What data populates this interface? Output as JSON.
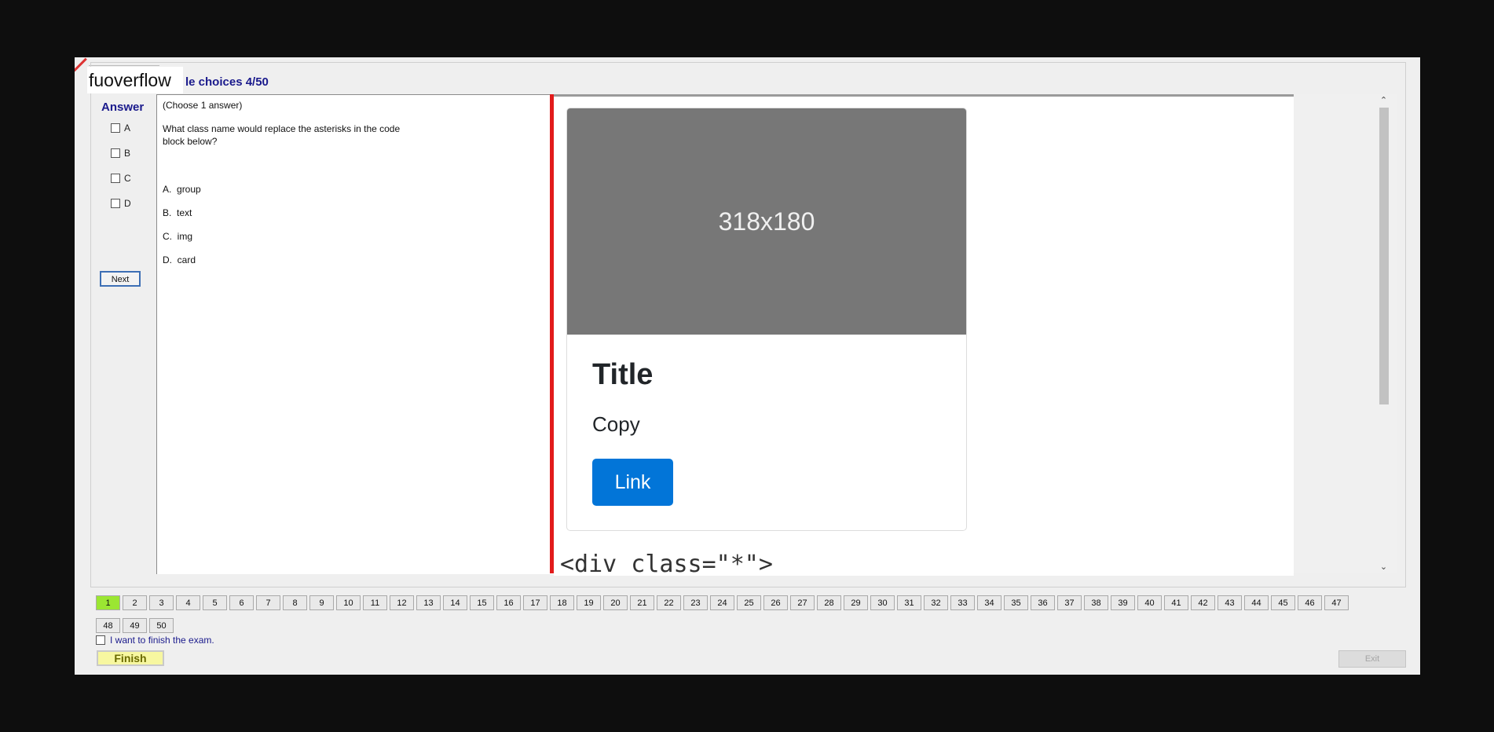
{
  "brand": {
    "name": "fuoverflow"
  },
  "question": {
    "header": "le choices 4/50",
    "instruction": "(Choose 1 answer)",
    "text_line1": "What class name would replace the asterisks in the code",
    "text_line2": "block below?",
    "options": [
      {
        "letter": "A.",
        "text": "group"
      },
      {
        "letter": "B.",
        "text": "text"
      },
      {
        "letter": "C.",
        "text": "img"
      },
      {
        "letter": "D.",
        "text": "card"
      }
    ]
  },
  "answer": {
    "heading": "Answer",
    "choices": [
      "A",
      "B",
      "C",
      "D"
    ],
    "next_label": "Next"
  },
  "preview": {
    "image_label": "318x180",
    "title": "Title",
    "copy": "Copy",
    "link": "Link",
    "code": "<div class=\"*\">"
  },
  "scrollbar": {
    "up": "⌃",
    "down": "⌄"
  },
  "navigation": {
    "current": 1,
    "numbers": [
      "1",
      "2",
      "3",
      "4",
      "5",
      "6",
      "7",
      "8",
      "9",
      "10",
      "11",
      "12",
      "13",
      "14",
      "15",
      "16",
      "17",
      "18",
      "19",
      "20",
      "21",
      "22",
      "23",
      "24",
      "25",
      "26",
      "27",
      "28",
      "29",
      "30",
      "31",
      "32",
      "33",
      "34",
      "35",
      "36",
      "37",
      "38",
      "39",
      "40",
      "41",
      "42",
      "43",
      "44",
      "45",
      "46",
      "47",
      "48",
      "49",
      "50"
    ]
  },
  "footer": {
    "finish_check_label": "I want to finish the exam.",
    "finish_label": "Finish",
    "exit_label": "Exit"
  },
  "colors": {
    "accent": "#1a1a8c",
    "current_question": "#9be632",
    "divider": "#e21b1b",
    "link_button": "#0275d8"
  }
}
